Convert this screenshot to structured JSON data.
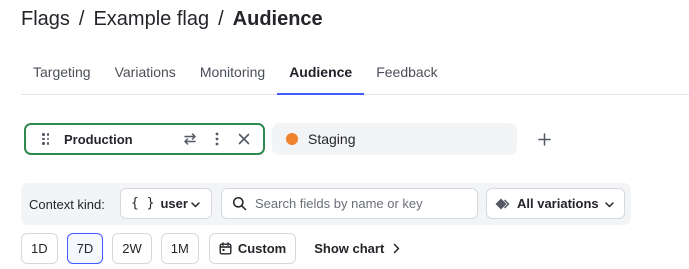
{
  "breadcrumb": {
    "items": [
      "Flags",
      "Example flag"
    ],
    "separator": "/",
    "current": "Audience"
  },
  "tabs": [
    {
      "label": "Targeting",
      "active": false
    },
    {
      "label": "Variations",
      "active": false
    },
    {
      "label": "Monitoring",
      "active": false
    },
    {
      "label": "Audience",
      "active": true
    },
    {
      "label": "Feedback",
      "active": false
    }
  ],
  "environments": {
    "selected": {
      "name": "Production",
      "icons": [
        "swap-icon",
        "more-vertical-icon",
        "close-icon"
      ]
    },
    "other": {
      "name": "Staging",
      "color": "#f0812d"
    },
    "add_icon": "plus-icon"
  },
  "filters": {
    "context_kind_label": "Context kind:",
    "context_kind_braces": "{ }",
    "context_kind_value": "user",
    "search_placeholder": "Search fields by name or key",
    "variations_value": "All variations"
  },
  "time_range": {
    "options": [
      "1D",
      "7D",
      "2W",
      "1M"
    ],
    "selected": "7D",
    "custom_label": "Custom",
    "show_chart_label": "Show chart"
  },
  "colors": {
    "accent": "#405bff",
    "production_border": "#2f8a4e",
    "staging_dot": "#f0812d"
  }
}
